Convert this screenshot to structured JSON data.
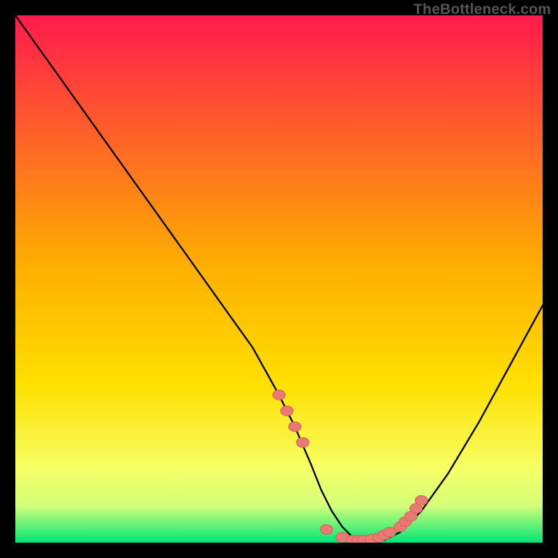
{
  "watermark": "TheBottleneck.com",
  "colors": {
    "background": "#000000",
    "gradient_top": "#ff1a4d",
    "gradient_mid": "#ffd400",
    "gradient_band": "#f7ff66",
    "gradient_bottom": "#00e676",
    "curve": "#000000",
    "marker_fill": "#e87a74",
    "marker_stroke": "#d85f58"
  },
  "chart_data": {
    "type": "line",
    "title": "",
    "xlabel": "",
    "ylabel": "",
    "xlim": [
      0,
      100
    ],
    "ylim": [
      0,
      100
    ],
    "grid": false,
    "series": [
      {
        "name": "bottleneck-curve",
        "x": [
          0,
          5,
          10,
          15,
          20,
          25,
          30,
          35,
          40,
          45,
          50,
          53,
          56,
          58,
          60,
          62,
          64,
          67,
          70,
          73,
          77,
          82,
          88,
          94,
          100
        ],
        "y": [
          100,
          93,
          86,
          79,
          72,
          65,
          58,
          51,
          44,
          37,
          28,
          22,
          15,
          10,
          6,
          3,
          1,
          0,
          0.5,
          2,
          6,
          13,
          23,
          34,
          45
        ]
      }
    ],
    "markers": {
      "name": "highlighted-points",
      "x": [
        50,
        51.5,
        53,
        54.5,
        59,
        62,
        64,
        65,
        66,
        67.5,
        69,
        70,
        71,
        73,
        74,
        75,
        76,
        77
      ],
      "y": [
        28,
        25,
        22,
        19,
        2.5,
        1,
        0.5,
        0.5,
        0.5,
        0.7,
        1,
        1.5,
        2,
        3,
        4,
        5,
        6.5,
        8
      ]
    }
  }
}
